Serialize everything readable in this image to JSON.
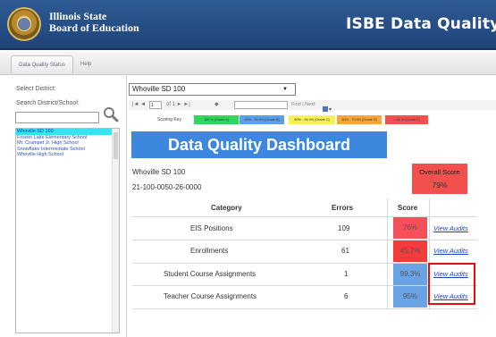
{
  "header": {
    "brand_line1": "Illinois State",
    "brand_line2": "Board of Education",
    "app_title": "ISBE Data Quality Dash"
  },
  "tabs": [
    {
      "label": "Data Quality Status",
      "active": true
    },
    {
      "label": "Help",
      "active": false
    }
  ],
  "sidebar": {
    "select_district_label": "Select District:",
    "search_label": "Search District/School:",
    "search_value": "",
    "schools": [
      {
        "name": "Whoville SD 100",
        "selected": true
      },
      {
        "name": "Frozen Lake Elementary School",
        "selected": false
      },
      {
        "name": "Mt. Crumpet Jr. High School",
        "selected": false
      },
      {
        "name": "Snowflake Intermediate School",
        "selected": false
      },
      {
        "name": "Whoville High School",
        "selected": false
      }
    ]
  },
  "district_select": {
    "value": "Whoville SD 100"
  },
  "toolbar": {
    "nav": "|◄ ◄",
    "page": "1",
    "of": "of 1 ► ►|",
    "zoom": "◆",
    "find_label": "Find | Next"
  },
  "scoring_key": {
    "label": "Scoring Key :",
    "items": [
      {
        "label": "100 % [Grade A]",
        "color": "#33d65c"
      },
      {
        "label": "99% - 99.9% [Grade B]",
        "color": "#5aa0e8"
      },
      {
        "label": "80% - 94.9% [Grade C]",
        "color": "#f7f05a"
      },
      {
        "label": "60% - 79.9% [Grade D]",
        "color": "#f5a53a"
      },
      {
        "label": "< 60 % [Grade F]",
        "color": "#f24f4f"
      }
    ]
  },
  "dashboard": {
    "banner": "Data Quality Dashboard",
    "district_name": "Whoville SD 100",
    "district_code": "21-100-0050-26-0000",
    "overall_label": "Overall Score",
    "overall_score": "79%",
    "overall_color": "#f24f4f",
    "columns": {
      "category": "Category",
      "errors": "Errors",
      "score": "Score"
    },
    "rows": [
      {
        "category": "EIS Positions",
        "errors": "109",
        "score": "76%",
        "score_color": "#f5505a",
        "link": "View Audits"
      },
      {
        "category": "Enrollments",
        "errors": "61",
        "score": "45.7%",
        "score_color": "#f23c3c",
        "link": "View Audits"
      },
      {
        "category": "Student Course Assignments",
        "errors": "1",
        "score": "99.3%",
        "score_color": "#6aa2e6",
        "link": "View Audits"
      },
      {
        "category": "Teacher Course Assignments",
        "errors": "6",
        "score": "95%",
        "score_color": "#6aa2e6",
        "link": "View Audits"
      }
    ]
  }
}
